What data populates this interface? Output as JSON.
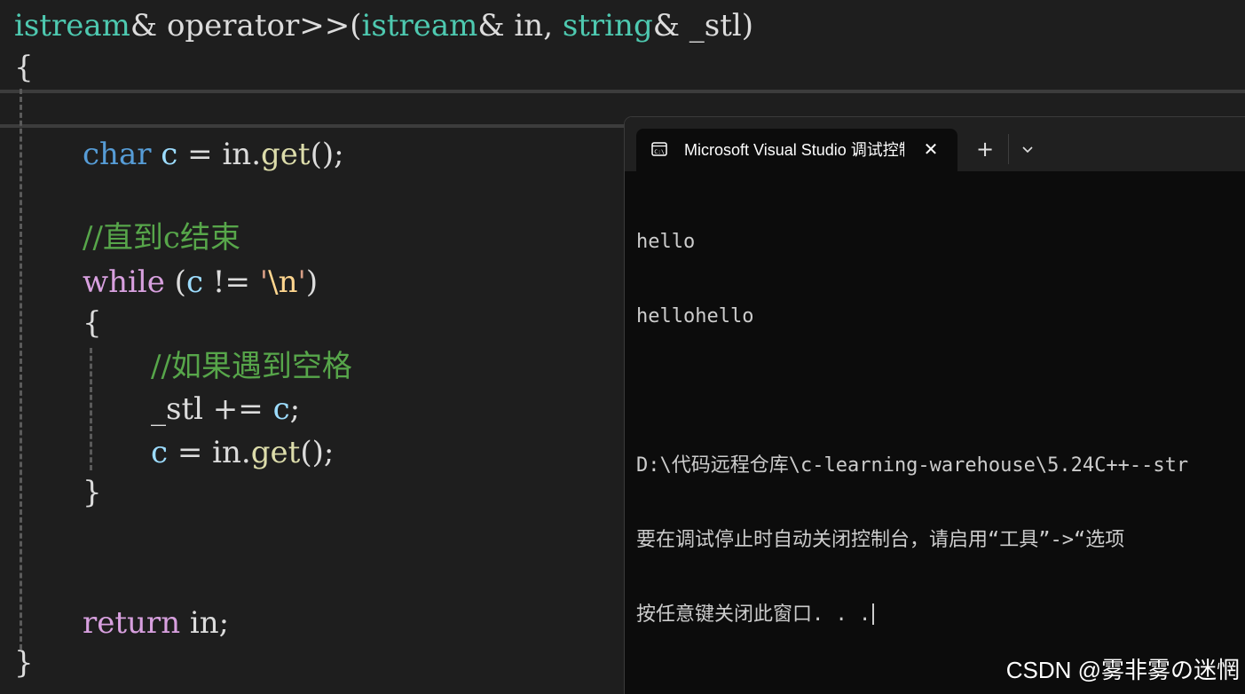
{
  "editor": {
    "signature": {
      "ret_type": "istream",
      "amp1": "&",
      "func": " operator>>(",
      "param1_type": "istream",
      "amp2": "&",
      "param1_name": " in, ",
      "param2_type": "string",
      "amp3": "&",
      "param2_name": " _stl)"
    },
    "open_brace": "{",
    "decl": {
      "type": "char",
      "var": "c",
      "assign": " = ",
      "obj": "in.",
      "fn": "get",
      "tail": "();"
    },
    "comment1": "//直到c结束",
    "while_stmt": {
      "kw": "while",
      "open": " (",
      "var": "c",
      "op": " != ",
      "q1": "'",
      "esc": "\\n",
      "q2": "'",
      "close": ")"
    },
    "inner_open": "{",
    "comment2": "//如果遇到空格",
    "append": {
      "lhs": "_stl",
      "op": " += ",
      "var": "c",
      "semi": ";"
    },
    "reassign": {
      "var": "c",
      "assign": " = ",
      "obj": "in.",
      "fn": "get",
      "tail": "();"
    },
    "inner_close": "}",
    "ret": {
      "kw": "return",
      "val": " in;"
    },
    "close_brace": "}"
  },
  "terminal": {
    "tab_title": "Microsoft Visual Studio 调试控制台",
    "close_glyph": "✕",
    "new_tab_glyph": "+",
    "lines": [
      "hello",
      "hellohello",
      "",
      "D:\\代码远程仓库\\c-learning-warehouse\\5.24C++--str",
      "要在调试停止时自动关闭控制台，请启用“工具”->“选项",
      "按任意键关闭此窗口. . ."
    ]
  },
  "watermark": "CSDN @雾非雾の迷惘",
  "icons": {
    "terminal_icon": "console-window-icon",
    "dropdown": "chevron-down-icon",
    "close": "close-icon"
  },
  "colors": {
    "editor_bg": "#1e1e1e",
    "type": "#4ec9b0",
    "keyword": "#569cd6",
    "control": "#d8a0df",
    "variable": "#9cdcfe",
    "function": "#dcdcaa",
    "comment": "#57a64a",
    "terminal_bg": "#0c0c0c"
  }
}
